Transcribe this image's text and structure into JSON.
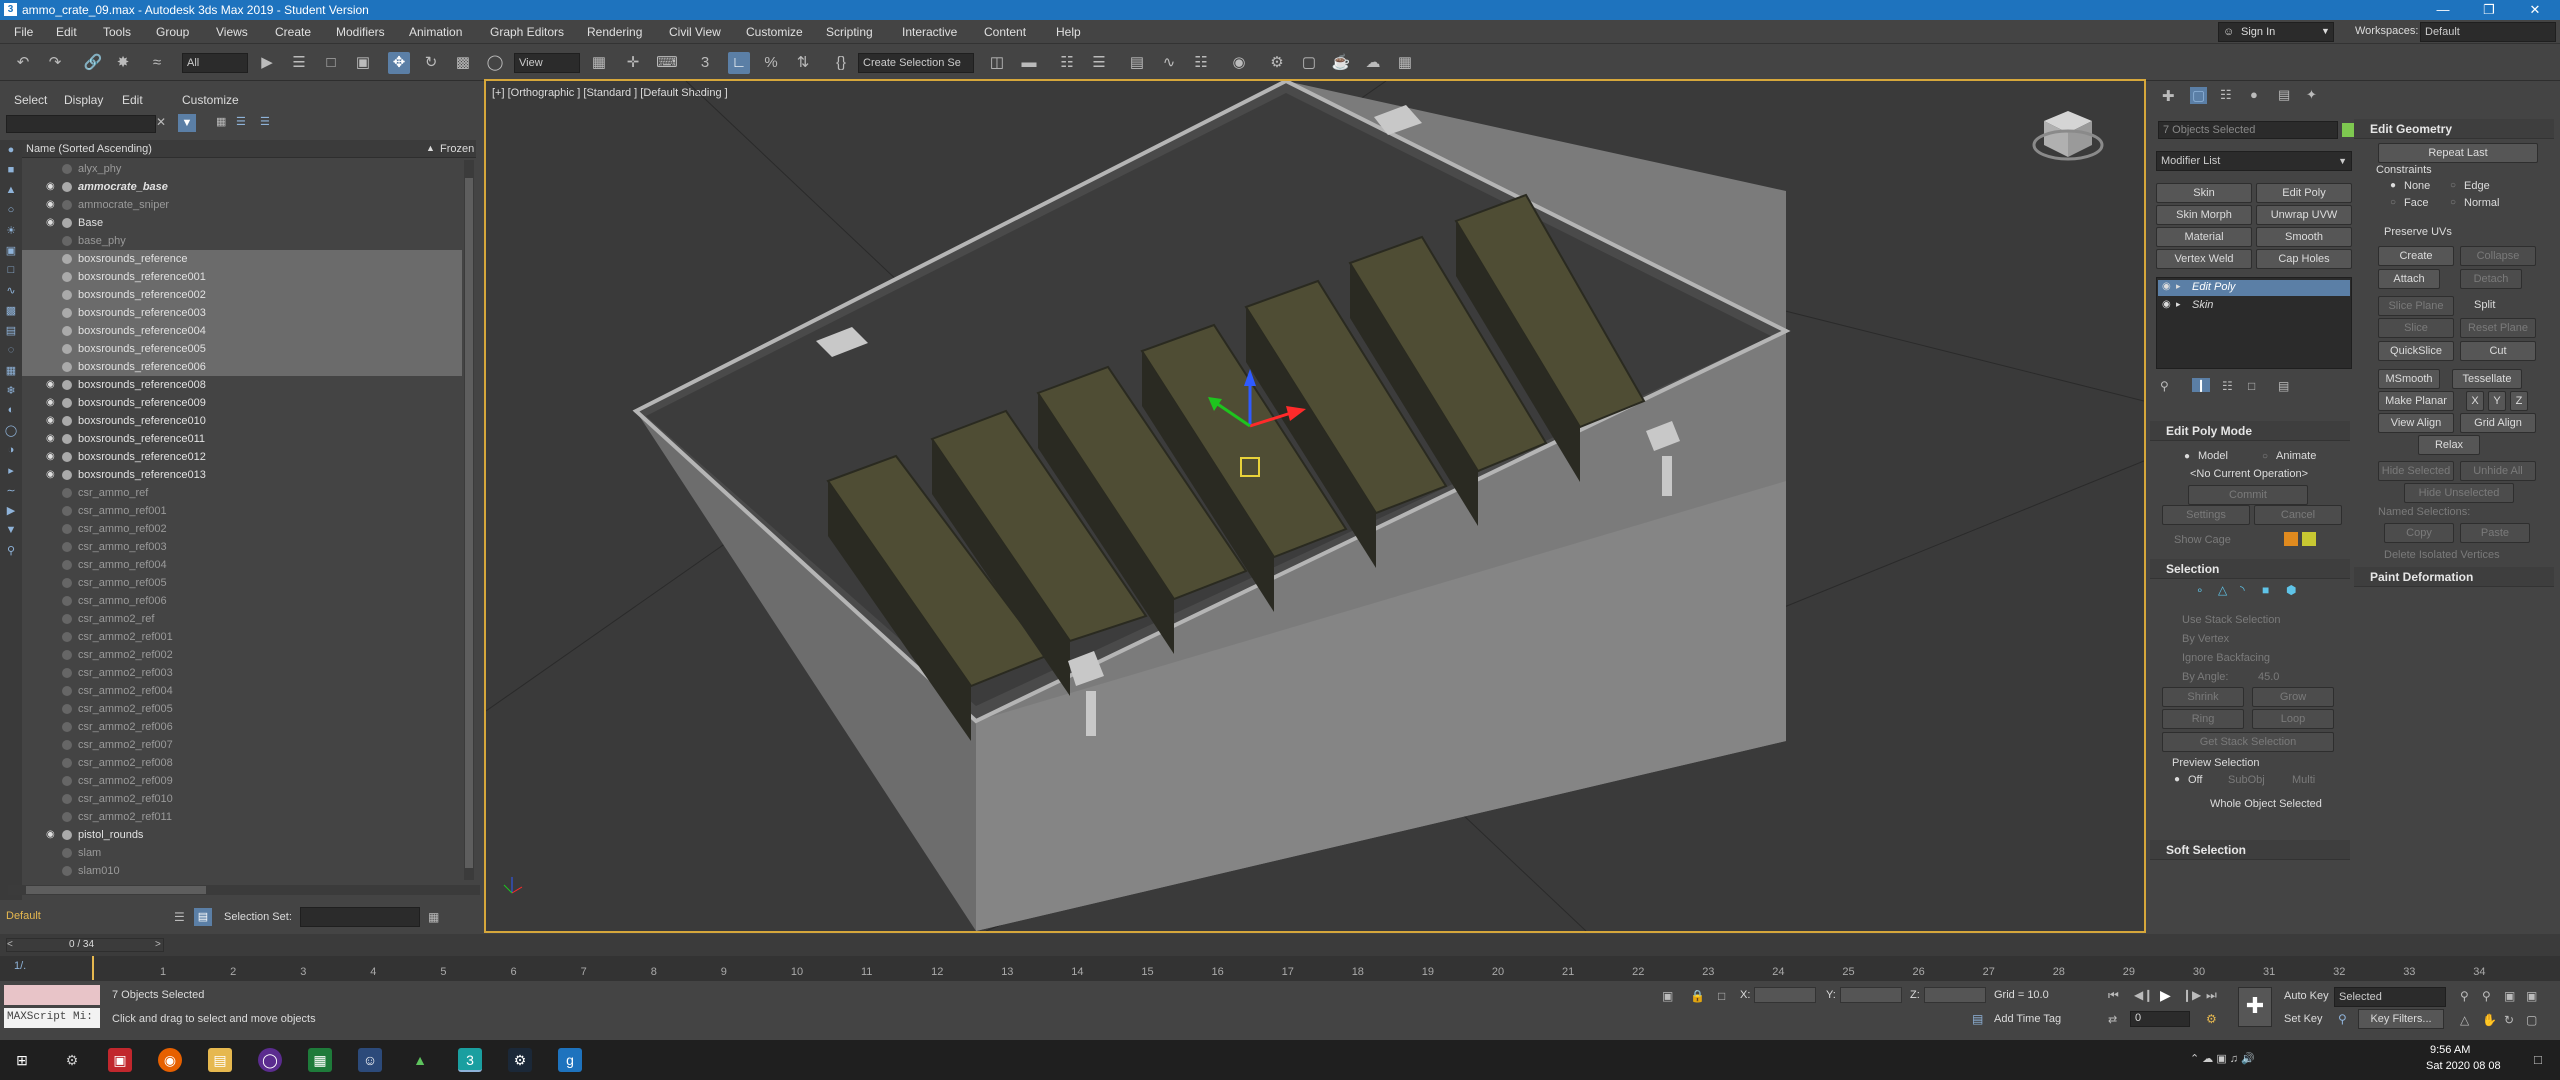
{
  "window": {
    "title": "ammo_crate_09.max - Autodesk 3ds Max 2019 - Student Version"
  },
  "menus": [
    "File",
    "Edit",
    "Tools",
    "Group",
    "Views",
    "Create",
    "Modifiers",
    "Animation",
    "Graph Editors",
    "Rendering",
    "Civil View",
    "Customize",
    "Scripting",
    "Interactive",
    "Content",
    "Help"
  ],
  "signin": {
    "label": "Sign In",
    "workspaces_label": "Workspaces:",
    "workspace_value": "Default"
  },
  "toolbar": {
    "filter_value": "All",
    "view_value": "View",
    "selection_set_placeholder": "Create Selection Se"
  },
  "scene_explorer": {
    "tabs": [
      "Select",
      "Display",
      "Edit",
      "Customize"
    ],
    "column_name": "Name (Sorted Ascending)",
    "column_frozen": "Frozen",
    "items": [
      {
        "name": "alyx_phy",
        "frozen": true,
        "selected": false,
        "visible": false
      },
      {
        "name": "ammocrate_base",
        "frozen": false,
        "selected": false,
        "visible": true,
        "bold": true
      },
      {
        "name": "ammocrate_sniper",
        "frozen": true,
        "selected": false,
        "visible": true
      },
      {
        "name": "Base",
        "frozen": false,
        "selected": false,
        "visible": true
      },
      {
        "name": "base_phy",
        "frozen": true,
        "selected": false,
        "visible": false
      },
      {
        "name": "boxsrounds_reference",
        "frozen": false,
        "selected": true,
        "visible": false
      },
      {
        "name": "boxsrounds_reference001",
        "frozen": false,
        "selected": true,
        "visible": false
      },
      {
        "name": "boxsrounds_reference002",
        "frozen": false,
        "selected": true,
        "visible": false
      },
      {
        "name": "boxsrounds_reference003",
        "frozen": false,
        "selected": true,
        "visible": false
      },
      {
        "name": "boxsrounds_reference004",
        "frozen": false,
        "selected": true,
        "visible": false
      },
      {
        "name": "boxsrounds_reference005",
        "frozen": false,
        "selected": true,
        "visible": false
      },
      {
        "name": "boxsrounds_reference006",
        "frozen": false,
        "selected": true,
        "visible": false
      },
      {
        "name": "boxsrounds_reference008",
        "frozen": false,
        "selected": false,
        "visible": true
      },
      {
        "name": "boxsrounds_reference009",
        "frozen": false,
        "selected": false,
        "visible": true
      },
      {
        "name": "boxsrounds_reference010",
        "frozen": false,
        "selected": false,
        "visible": true
      },
      {
        "name": "boxsrounds_reference011",
        "frozen": false,
        "selected": false,
        "visible": true
      },
      {
        "name": "boxsrounds_reference012",
        "frozen": false,
        "selected": false,
        "visible": true
      },
      {
        "name": "boxsrounds_reference013",
        "frozen": false,
        "selected": false,
        "visible": true
      },
      {
        "name": "csr_ammo_ref",
        "frozen": true,
        "selected": false,
        "visible": false
      },
      {
        "name": "csr_ammo_ref001",
        "frozen": true,
        "selected": false,
        "visible": false
      },
      {
        "name": "csr_ammo_ref002",
        "frozen": true,
        "selected": false,
        "visible": false
      },
      {
        "name": "csr_ammo_ref003",
        "frozen": true,
        "selected": false,
        "visible": false
      },
      {
        "name": "csr_ammo_ref004",
        "frozen": true,
        "selected": false,
        "visible": false
      },
      {
        "name": "csr_ammo_ref005",
        "frozen": true,
        "selected": false,
        "visible": false
      },
      {
        "name": "csr_ammo_ref006",
        "frozen": true,
        "selected": false,
        "visible": false
      },
      {
        "name": "csr_ammo2_ref",
        "frozen": true,
        "selected": false,
        "visible": false
      },
      {
        "name": "csr_ammo2_ref001",
        "frozen": true,
        "selected": false,
        "visible": false
      },
      {
        "name": "csr_ammo2_ref002",
        "frozen": true,
        "selected": false,
        "visible": false
      },
      {
        "name": "csr_ammo2_ref003",
        "frozen": true,
        "selected": false,
        "visible": false
      },
      {
        "name": "csr_ammo2_ref004",
        "frozen": true,
        "selected": false,
        "visible": false
      },
      {
        "name": "csr_ammo2_ref005",
        "frozen": true,
        "selected": false,
        "visible": false
      },
      {
        "name": "csr_ammo2_ref006",
        "frozen": true,
        "selected": false,
        "visible": false
      },
      {
        "name": "csr_ammo2_ref007",
        "frozen": true,
        "selected": false,
        "visible": false
      },
      {
        "name": "csr_ammo2_ref008",
        "frozen": true,
        "selected": false,
        "visible": false
      },
      {
        "name": "csr_ammo2_ref009",
        "frozen": true,
        "selected": false,
        "visible": false
      },
      {
        "name": "csr_ammo2_ref010",
        "frozen": true,
        "selected": false,
        "visible": false
      },
      {
        "name": "csr_ammo2_ref011",
        "frozen": true,
        "selected": false,
        "visible": false
      },
      {
        "name": "pistol_rounds",
        "frozen": false,
        "selected": false,
        "visible": true
      },
      {
        "name": "slam",
        "frozen": true,
        "selected": false,
        "visible": false
      },
      {
        "name": "slam010",
        "frozen": true,
        "selected": false,
        "visible": false
      }
    ],
    "layer_value": "Default",
    "selection_set_label": "Selection Set:"
  },
  "viewport": {
    "label": "[+] [Orthographic ] [Standard ] [Default Shading ]"
  },
  "command_panel": {
    "objects_selected": "7 Objects Selected",
    "modifier_list": "Modifier List",
    "modifier_buttons": [
      "Skin",
      "Edit Poly",
      "Skin Morph",
      "Unwrap UVW",
      "Material",
      "Smooth",
      "Vertex Weld",
      "Cap Holes"
    ],
    "stack": [
      "Edit Poly",
      "Skin"
    ],
    "edit_poly_mode": {
      "title": "Edit Poly Mode",
      "model": "Model",
      "animate": "Animate",
      "no_op": "<No Current Operation>",
      "commit": "Commit",
      "settings": "Settings",
      "cancel": "Cancel",
      "show_cage": "Show Cage"
    },
    "selection": {
      "title": "Selection",
      "use_stack": "Use Stack Selection",
      "by_vertex": "By Vertex",
      "ignore_backfacing": "Ignore Backfacing",
      "by_angle": "By Angle:",
      "angle_value": "45.0",
      "shrink": "Shrink",
      "grow": "Grow",
      "ring": "Ring",
      "loop": "Loop",
      "get_stack": "Get Stack Selection",
      "preview": "Preview Selection",
      "off": "Off",
      "subobj": "SubObj",
      "multi": "Multi",
      "whole": "Whole Object Selected"
    },
    "soft_selection": "Soft Selection",
    "edit_geometry": {
      "title": "Edit Geometry",
      "repeat_last": "Repeat Last",
      "constraints": "Constraints",
      "none": "None",
      "edge": "Edge",
      "face": "Face",
      "normal": "Normal",
      "preserve_uvs": "Preserve UVs",
      "create": "Create",
      "collapse": "Collapse",
      "attach": "Attach",
      "detach": "Detach",
      "slice_plane": "Slice Plane",
      "split": "Split",
      "slice": "Slice",
      "reset_plane": "Reset Plane",
      "quickslice": "QuickSlice",
      "cut": "Cut",
      "msmooth": "MSmooth",
      "tessellate": "Tessellate",
      "make_planar": "Make Planar",
      "x": "X",
      "y": "Y",
      "z": "Z",
      "view_align": "View Align",
      "grid_align": "Grid Align",
      "relax": "Relax",
      "hide_selected": "Hide Selected",
      "unhide_all": "Unhide All",
      "hide_unselected": "Hide Unselected",
      "named_selections": "Named Selections:",
      "copy": "Copy",
      "paste": "Paste",
      "delete_isolated": "Delete Isolated Vertices"
    },
    "paint_deformation": "Paint Deformation"
  },
  "timeline": {
    "frame_counter": "0 / 34",
    "ticks": [
      "1",
      "2",
      "3",
      "4",
      "5",
      "6",
      "7",
      "8",
      "9",
      "10",
      "11",
      "12",
      "13",
      "14",
      "15",
      "16",
      "17",
      "18",
      "19",
      "20",
      "21",
      "22",
      "23",
      "24",
      "25",
      "26",
      "27",
      "28",
      "29",
      "30",
      "31",
      "32",
      "33",
      "34"
    ]
  },
  "status": {
    "objects_selected": "7 Objects Selected",
    "prompt": "Click and drag to select and move objects",
    "maxscript": "MAXScript Mi:",
    "x_label": "X:",
    "y_label": "Y:",
    "z_label": "Z:",
    "grid": "Grid = 10.0",
    "add_time_tag": "Add Time Tag",
    "auto_key": "Auto Key",
    "selected": "Selected",
    "set_key": "Set Key",
    "key_filters": "Key Filters...",
    "frame_value": "0"
  },
  "taskbar": {
    "time": "9:56 AM",
    "date": "Sat 2020 08 08"
  }
}
